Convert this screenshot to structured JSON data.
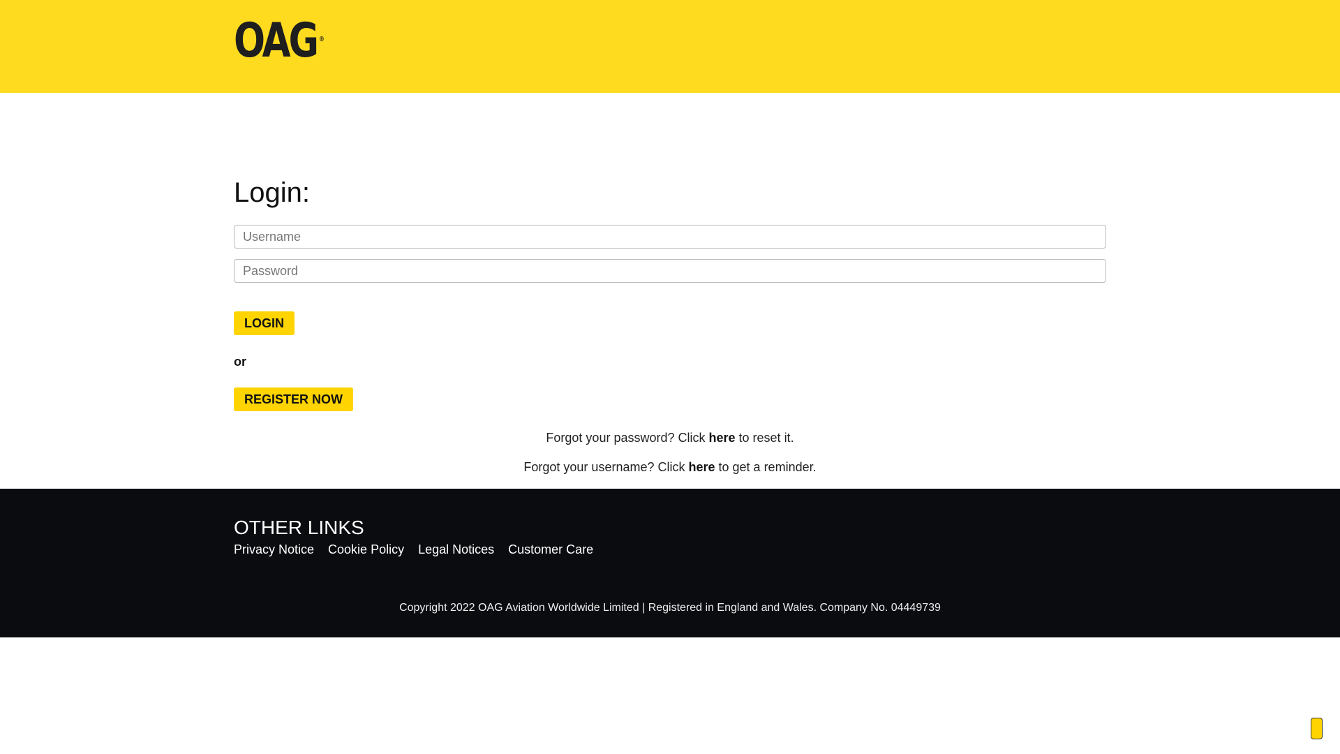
{
  "header": {
    "logo": "OAG",
    "logo_mark": "®"
  },
  "login": {
    "title": "Login:",
    "username_placeholder": "Username",
    "password_placeholder": "Password",
    "login_label": "LOGIN",
    "or": "or",
    "register_label": "REGISTER NOW",
    "forgot_password": {
      "before": "Forgot your password? Click ",
      "link": "here",
      "after": " to reset it."
    },
    "forgot_username": {
      "before": "Forgot your username? Click ",
      "link": "here",
      "after": " to get a reminder."
    }
  },
  "footer": {
    "title": "OTHER LINKS",
    "links": [
      "Privacy Notice",
      "Cookie Policy",
      "Legal Notices",
      "Customer Care"
    ],
    "copyright": "Copyright 2022 OAG Aviation Worldwide Limited | Registered in England and Wales. Company No. 04449739"
  },
  "colors": {
    "brand": "#ffdb1f",
    "button": "#ffd400",
    "footer": "#0b0c10"
  }
}
